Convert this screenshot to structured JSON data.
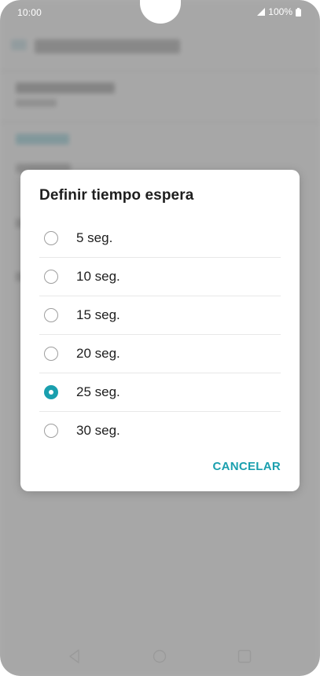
{
  "status_bar": {
    "time": "10:00",
    "battery": "100%",
    "icons": [
      "signal-icon",
      "battery-icon"
    ]
  },
  "dialog": {
    "title": "Definir tiempo espera",
    "options": [
      {
        "label": "5 seg.",
        "selected": false
      },
      {
        "label": "10 seg.",
        "selected": false
      },
      {
        "label": "15 seg.",
        "selected": false
      },
      {
        "label": "20 seg.",
        "selected": false
      },
      {
        "label": "25 seg.",
        "selected": true
      },
      {
        "label": "30 seg.",
        "selected": false
      }
    ],
    "cancel_label": "CANCELAR"
  },
  "navigation": {
    "icons": [
      "back-icon",
      "home-icon",
      "recents-icon"
    ]
  },
  "colors": {
    "accent": "#1a9fae",
    "scrim": "rgba(0,0,0,0.32)"
  }
}
